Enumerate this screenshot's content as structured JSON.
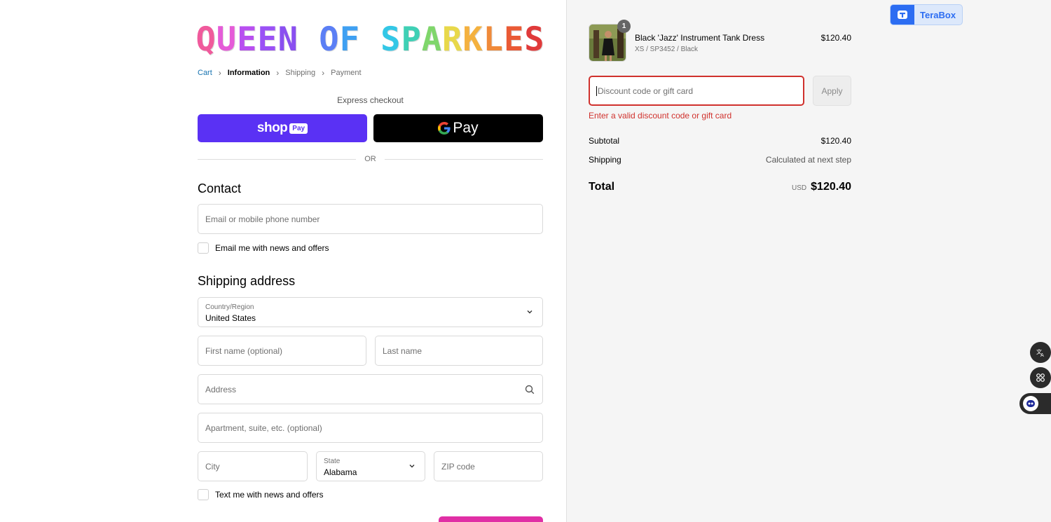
{
  "store": {
    "logo_letters": [
      "Q",
      "U",
      "E",
      "E",
      "N",
      " ",
      "O",
      "F",
      " ",
      "S",
      "P",
      "A",
      "R",
      "K",
      "L",
      "E",
      "S"
    ],
    "logo_colors": [
      "#f05a9c",
      "#e55bd8",
      "#b84ff0",
      "#9a51f5",
      "#8a4ff0",
      "#ffffff",
      "#5b7ff5",
      "#3fa0f2",
      "#ffffff",
      "#33c7e6",
      "#3fd0b5",
      "#7fd66b",
      "#e8d84a",
      "#f4b13f",
      "#f08a3a",
      "#ea5a35",
      "#e03a3a"
    ]
  },
  "breadcrumb": {
    "cart": "Cart",
    "information": "Information",
    "shipping": "Shipping",
    "payment": "Payment"
  },
  "express": {
    "label": "Express checkout",
    "shop_word": "shop",
    "shop_pay": "Pay",
    "gpay_word": "Pay",
    "or": "OR"
  },
  "contact": {
    "heading": "Contact",
    "email_placeholder": "Email or mobile phone number",
    "email_news": "Email me with news and offers"
  },
  "shipping": {
    "heading": "Shipping address",
    "country_label": "Country/Region",
    "country_value": "United States",
    "first_name": "First name (optional)",
    "last_name": "Last name",
    "address": "Address",
    "apartment": "Apartment, suite, etc. (optional)",
    "city": "City",
    "state_label": "State",
    "state_value": "Alabama",
    "zip": "ZIP code",
    "text_news": "Text me with news and offers"
  },
  "order": {
    "qty": "1",
    "product_name": "Black 'Jazz' Instrument Tank Dress",
    "variant": "XS / SP3452 / Black",
    "price": "$120.40",
    "discount_placeholder": "Discount code or gift card",
    "apply": "Apply",
    "error": "Enter a valid discount code or gift card",
    "subtotal_label": "Subtotal",
    "subtotal": "$120.40",
    "shipping_label": "Shipping",
    "shipping_value": "Calculated at next step",
    "total_label": "Total",
    "currency": "USD",
    "total": "$120.40"
  },
  "extension": {
    "terabox": "TeraBox"
  },
  "colors": {
    "shop_pay": "#5a31f4",
    "error": "#d0312d",
    "continue": "#e02fa5",
    "link": "#1773b0"
  }
}
